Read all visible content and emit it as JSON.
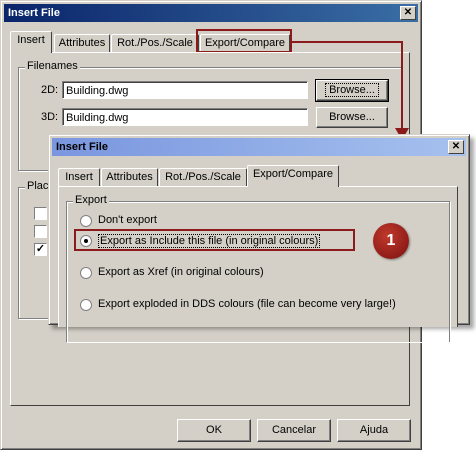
{
  "background_dialog": {
    "title": "Insert File",
    "tabs": [
      "Insert",
      "Attributes",
      "Rot./Pos./Scale",
      "Export/Compare"
    ],
    "filenames": {
      "group_label": "Filenames",
      "row_2d": {
        "label": "2D:",
        "value": "Building.dwg",
        "browse": "Browse..."
      },
      "row_3d": {
        "label": "3D:",
        "value": "Building.dwg",
        "browse": "Browse..."
      }
    },
    "placement_group_label": "Plac",
    "checkboxes": [
      false,
      false,
      true
    ],
    "buttons": {
      "ok": "OK",
      "cancel": "Cancelar",
      "help": "Ajuda"
    }
  },
  "front_dialog": {
    "title": "Insert File",
    "tabs": [
      "Insert",
      "Attributes",
      "Rot./Pos./Scale",
      "Export/Compare"
    ],
    "export": {
      "group_label": "Export",
      "options": [
        {
          "label": "Don't export",
          "selected": false
        },
        {
          "label": "Export as Include this file (in original colours)",
          "selected": true
        },
        {
          "label": "Export as Xref (in original colours)",
          "selected": false
        },
        {
          "label": "Export exploded in DDS colours (file can become very large!)",
          "selected": false
        }
      ]
    }
  },
  "annotations": {
    "callout_number": "1",
    "highlight_color": "#8b1a1a"
  }
}
